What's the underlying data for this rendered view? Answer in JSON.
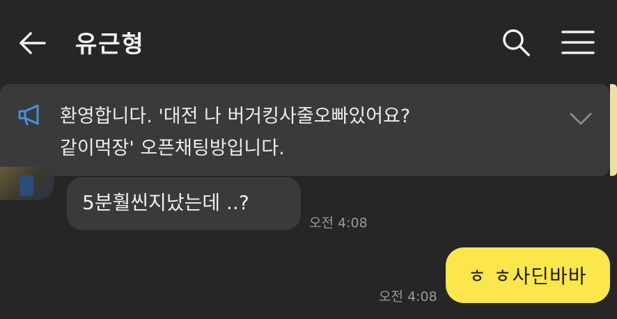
{
  "header": {
    "title": "유근형",
    "icons": {
      "back": "arrow-left-icon",
      "search": "search-icon",
      "menu": "hamburger-menu-icon"
    }
  },
  "notice": {
    "icon": "megaphone-icon",
    "text": "환영합니다. '대전 나 버거킹사줄오빠있어요?\n같이먹장' 오픈채팅방입니다.",
    "expand_icon": "chevron-down-icon"
  },
  "messages": [
    {
      "sender": "other",
      "text": "5분훨씬지났는데 ..?",
      "time": "오전 4:08"
    },
    {
      "sender": "me",
      "text": "ㅎ ㅎ사딘바바",
      "time": "오전 4:08"
    }
  ],
  "colors": {
    "background": "#262626",
    "bubble_other": "#3a3a3a",
    "bubble_me": "#fbe74b",
    "icon_blue": "#4a8fe0"
  }
}
